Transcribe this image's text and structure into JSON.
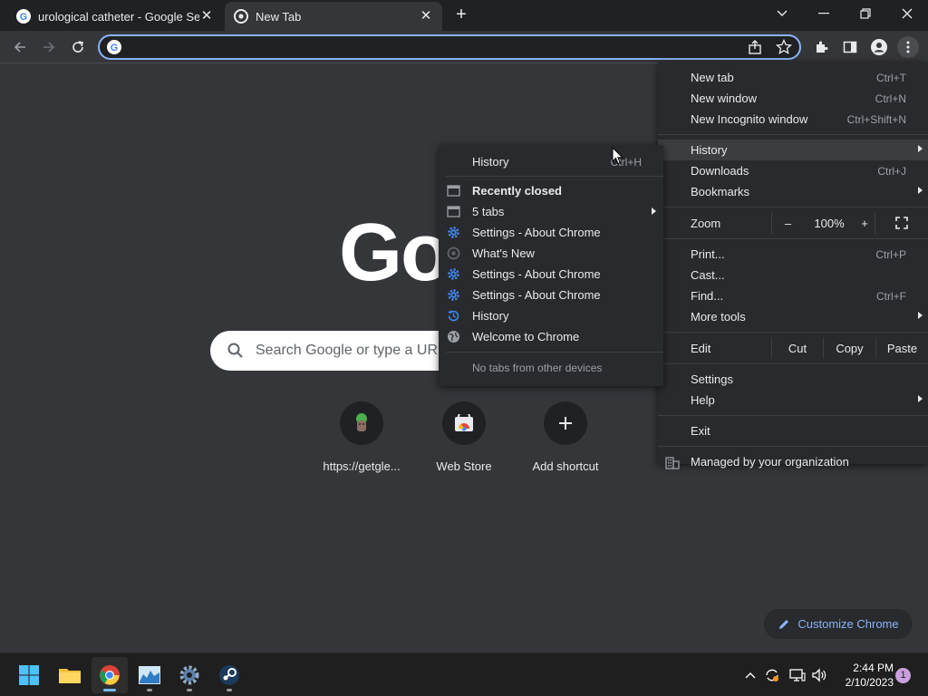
{
  "tabs": [
    {
      "title": "urological catheter - Google Search"
    },
    {
      "title": "New Tab"
    }
  ],
  "omnibox": {
    "value": ""
  },
  "ntp": {
    "logo_text": "Google",
    "search_placeholder": "Search Google or type a URL",
    "shortcuts": [
      {
        "label": "https://getgle..."
      },
      {
        "label": "Web Store"
      },
      {
        "label": "Add shortcut"
      }
    ],
    "customize_label": "Customize Chrome"
  },
  "menu": {
    "new_tab": {
      "label": "New tab",
      "shortcut": "Ctrl+T"
    },
    "new_window": {
      "label": "New window",
      "shortcut": "Ctrl+N"
    },
    "new_incognito": {
      "label": "New Incognito window",
      "shortcut": "Ctrl+Shift+N"
    },
    "history": {
      "label": "History"
    },
    "downloads": {
      "label": "Downloads",
      "shortcut": "Ctrl+J"
    },
    "bookmarks": {
      "label": "Bookmarks"
    },
    "zoom": {
      "label": "Zoom",
      "minus": "–",
      "level": "100%",
      "plus": "+"
    },
    "print": {
      "label": "Print...",
      "shortcut": "Ctrl+P"
    },
    "cast": {
      "label": "Cast..."
    },
    "find": {
      "label": "Find...",
      "shortcut": "Ctrl+F"
    },
    "more_tools": {
      "label": "More tools"
    },
    "edit": {
      "label": "Edit",
      "cut": "Cut",
      "copy": "Copy",
      "paste": "Paste"
    },
    "settings": {
      "label": "Settings"
    },
    "help": {
      "label": "Help"
    },
    "exit": {
      "label": "Exit"
    },
    "managed": {
      "label": "Managed by your organization"
    }
  },
  "history_submenu": {
    "history": {
      "label": "History",
      "shortcut": "Ctrl+H"
    },
    "recently_closed": "Recently closed",
    "items": [
      {
        "label": "5 tabs",
        "icon": "window-icon"
      },
      {
        "label": "Settings - About Chrome",
        "icon": "settings-gear-icon"
      },
      {
        "label": "What's New",
        "icon": "chrome-icon"
      },
      {
        "label": "Settings - About Chrome",
        "icon": "settings-gear-icon"
      },
      {
        "label": "Settings - About Chrome",
        "icon": "settings-gear-icon"
      },
      {
        "label": "History",
        "icon": "history-icon"
      },
      {
        "label": "Welcome to Chrome",
        "icon": "globe-icon"
      }
    ],
    "no_tabs": "No tabs from other devices"
  },
  "taskbar": {
    "time": "2:44 PM",
    "date": "2/10/2023",
    "notification_count": "1"
  },
  "colors": {
    "accent": "#8ab4f8",
    "background": "#35363a",
    "menu_bg": "#292a2d"
  }
}
